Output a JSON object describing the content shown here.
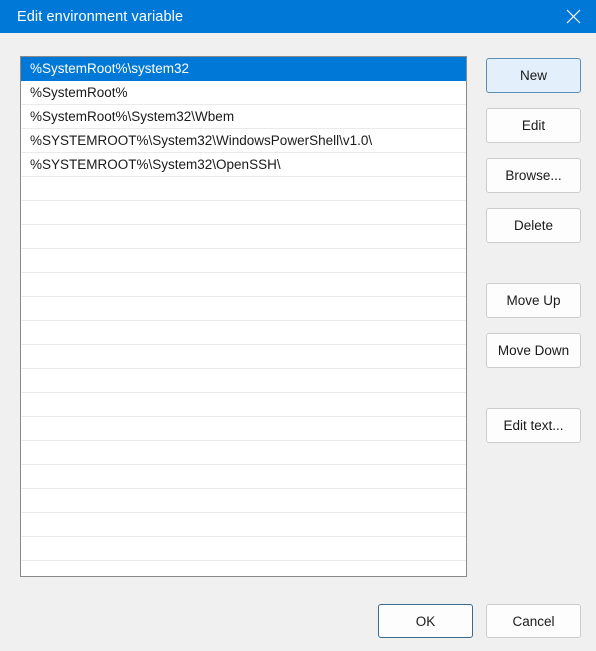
{
  "window": {
    "title": "Edit environment variable",
    "close_icon": "close-icon"
  },
  "colors": {
    "titlebar": "#0078d7",
    "selection": "#0078d7",
    "dialog_background": "#f0f0f0",
    "listbox_background": "#ffffff",
    "default_button_fill": "#e3f0fb",
    "default_button_border": "#5d8fb5"
  },
  "list": {
    "selected_index": 0,
    "total_rows": 21,
    "entries": [
      "%SystemRoot%\\system32",
      "%SystemRoot%",
      "%SystemRoot%\\System32\\Wbem",
      "%SYSTEMROOT%\\System32\\WindowsPowerShell\\v1.0\\",
      "%SYSTEMROOT%\\System32\\OpenSSH\\"
    ]
  },
  "side_buttons": [
    {
      "label": "New",
      "name": "new-button",
      "is_default": true
    },
    {
      "label": "Edit",
      "name": "edit-button",
      "is_default": false
    },
    {
      "label": "Browse...",
      "name": "browse-button",
      "is_default": false
    },
    {
      "label": "Delete",
      "name": "delete-button",
      "is_default": false
    },
    {
      "label": "Move Up",
      "name": "move-up-button",
      "is_default": false
    },
    {
      "label": "Move Down",
      "name": "move-down-button",
      "is_default": false
    },
    {
      "label": "Edit text...",
      "name": "edit-text-button",
      "is_default": false
    }
  ],
  "footer": {
    "ok_label": "OK",
    "cancel_label": "Cancel"
  }
}
